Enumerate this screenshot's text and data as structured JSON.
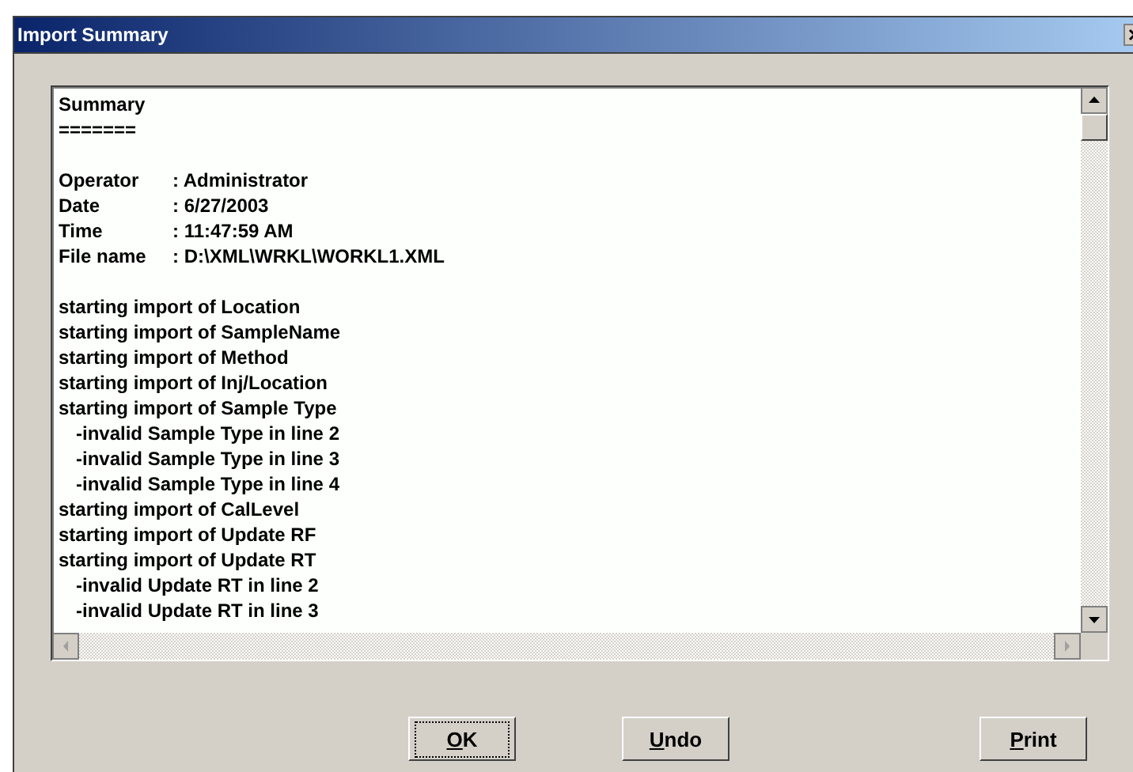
{
  "window": {
    "title": "Import Summary"
  },
  "summary": {
    "heading": "Summary",
    "underline": "=======",
    "fields": [
      {
        "label": "Operator",
        "value": ": Administrator"
      },
      {
        "label": "Date",
        "value": ": 6/27/2003"
      },
      {
        "label": "Time",
        "value": ": 11:47:59 AM"
      },
      {
        "label": "File name",
        "value": ": D:\\XML\\WRKL\\WORKL1.XML"
      }
    ],
    "log": [
      {
        "kind": "step",
        "text": "starting import of Location"
      },
      {
        "kind": "step",
        "text": "starting import of SampleName"
      },
      {
        "kind": "step",
        "text": "starting import of Method"
      },
      {
        "kind": "step",
        "text": "starting import of Inj/Location"
      },
      {
        "kind": "step",
        "text": "starting import of Sample Type"
      },
      {
        "kind": "error",
        "text": "-invalid Sample Type in line 2"
      },
      {
        "kind": "error",
        "text": "-invalid Sample Type in line 3"
      },
      {
        "kind": "error",
        "text": "-invalid Sample Type in line 4"
      },
      {
        "kind": "step",
        "text": "starting import of CalLevel"
      },
      {
        "kind": "step",
        "text": "starting import of Update RF"
      },
      {
        "kind": "step",
        "text": "starting import of Update RT"
      },
      {
        "kind": "error",
        "text": "-invalid Update RT in line 2"
      },
      {
        "kind": "error",
        "text": "-invalid Update RT in line 3"
      }
    ]
  },
  "buttons": [
    {
      "label": "OK",
      "focused": true
    },
    {
      "label": "Undo",
      "focused": false
    },
    {
      "label": "Print",
      "focused": false
    }
  ]
}
